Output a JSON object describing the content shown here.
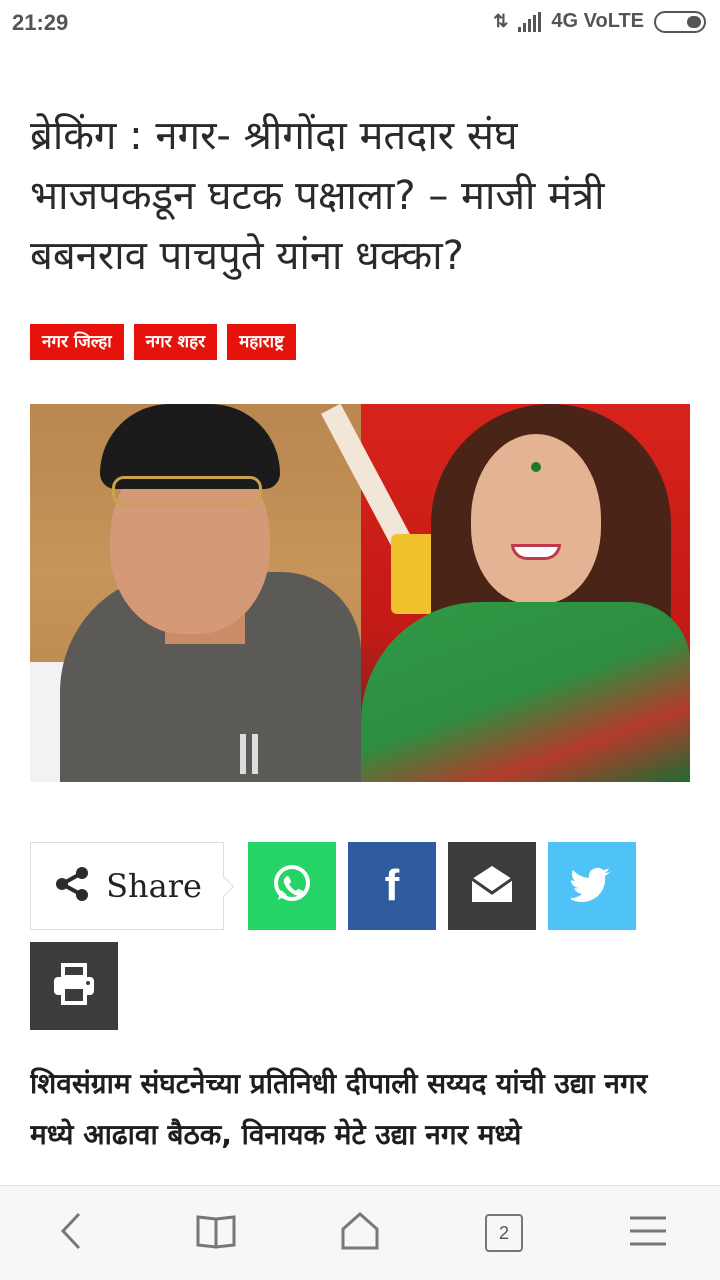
{
  "status_bar": {
    "time": "21:29",
    "network": "4G VoLTE"
  },
  "article": {
    "headline": "ब्रेकिंग : नगर- श्रीगोंदा मतदार संघ भाजपकडून घटक पक्षाला? – माजी मंत्री बबनराव पाचपुते यांना धक्का?",
    "tags": [
      "नगर जिल्हा",
      "नगर शहर",
      "महाराष्ट्र"
    ],
    "summary": "शिवसंग्राम संघटनेच्या प्रतिनिधी दीपाली सय्यद यांची उद्या नगर मध्ये आढावा बैठक, विनायक मेटे उद्या नगर मध्ये"
  },
  "share": {
    "label": "Share",
    "buttons": [
      "whatsapp",
      "facebook",
      "email",
      "twitter",
      "print"
    ]
  },
  "bottom_nav": {
    "tab_count": "2"
  },
  "colors": {
    "tag_red": "#e8120c",
    "whatsapp": "#25d366",
    "facebook": "#2f5b9e",
    "email": "#3c3c3c",
    "twitter": "#4fc3f7",
    "print": "#3c3c3c"
  },
  "icons": {
    "share": "share-icon",
    "whatsapp": "whatsapp-icon",
    "facebook": "facebook-icon",
    "email": "envelope-icon",
    "twitter": "twitter-bird-icon",
    "print": "printer-icon",
    "back": "chevron-left-icon",
    "bookmarks": "book-icon",
    "home": "home-icon",
    "menu": "hamburger-icon"
  }
}
